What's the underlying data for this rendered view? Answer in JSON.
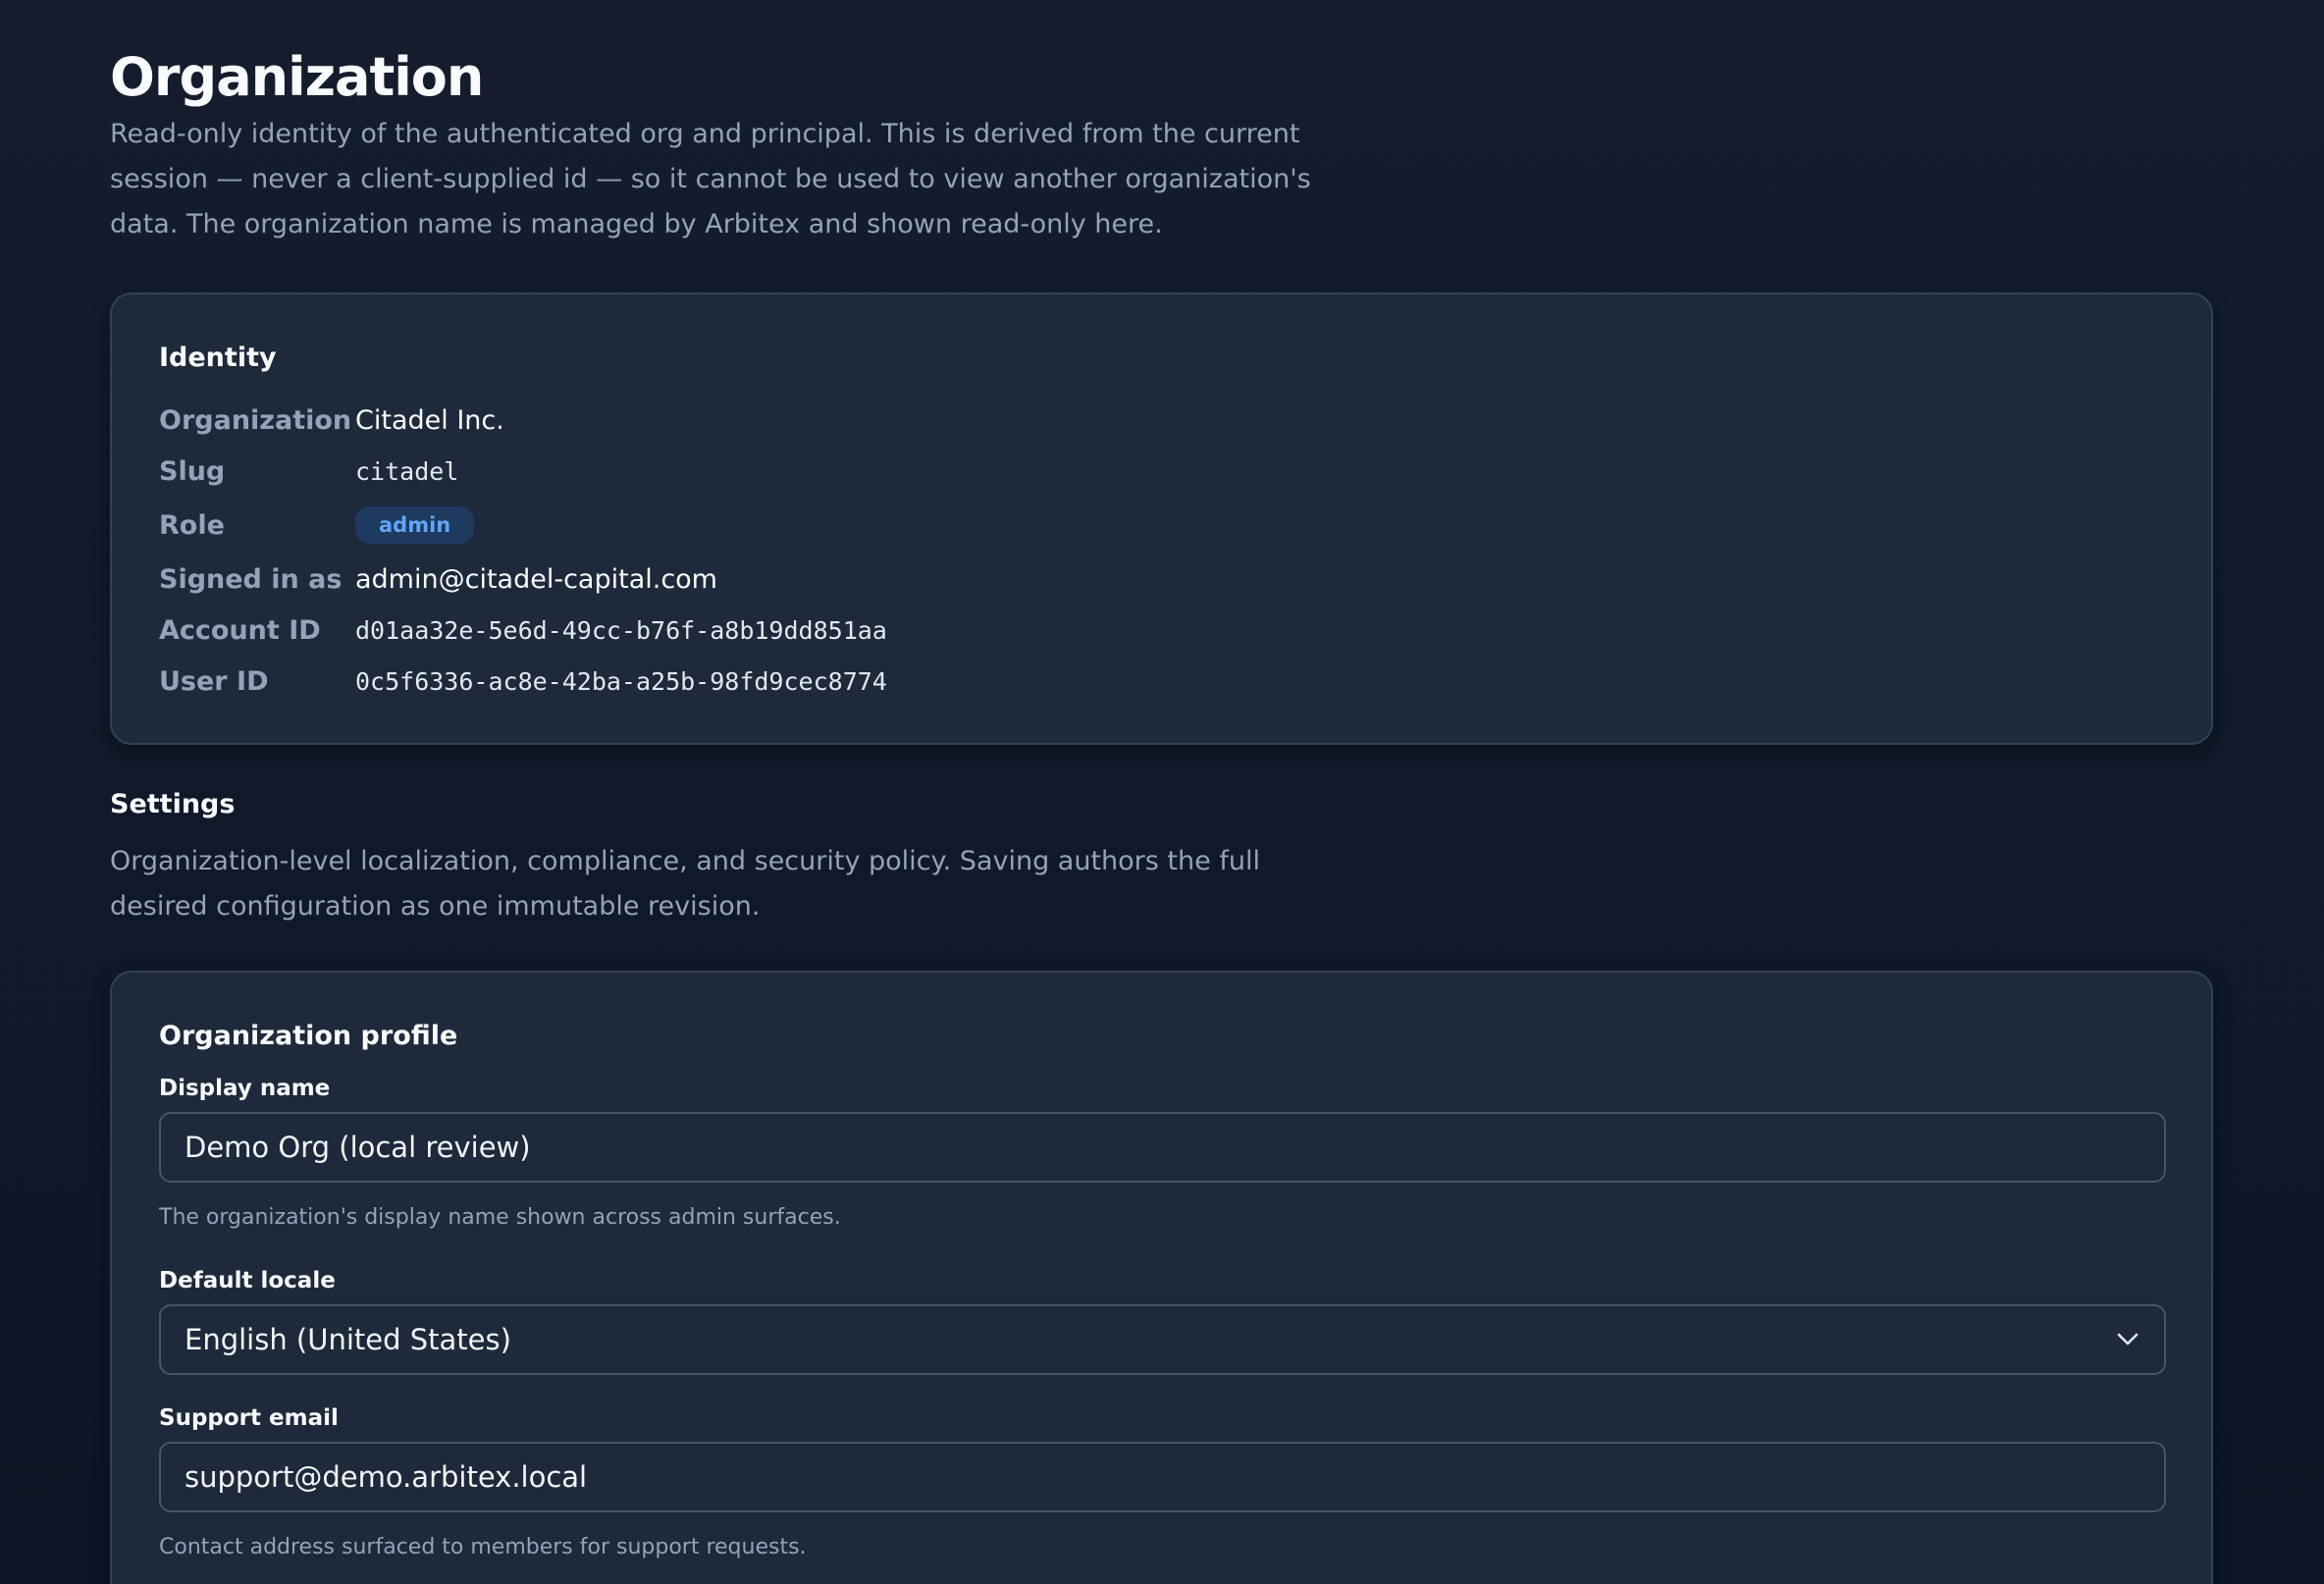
{
  "header": {
    "title": "Organization",
    "description": "Read-only identity of the authenticated org and principal. This is derived from the current session — never a client-supplied id — so it cannot be used to view another organization's data. The organization name is managed by Arbitex and shown read-only here."
  },
  "identity": {
    "title": "Identity",
    "rows": [
      {
        "label": "Organization",
        "value": "Citadel Inc."
      },
      {
        "label": "Slug",
        "value": "citadel"
      },
      {
        "label": "Role",
        "value": "admin"
      },
      {
        "label": "Signed in as",
        "value": "admin@citadel-capital.com"
      },
      {
        "label": "Account ID",
        "value": "d01aa32e-5e6d-49cc-b76f-a8b19dd851aa"
      },
      {
        "label": "User ID",
        "value": "0c5f6336-ac8e-42ba-a25b-98fd9cec8774"
      }
    ]
  },
  "settings": {
    "title": "Settings",
    "description": "Organization-level localization, compliance, and security policy. Saving authors the full desired configuration as one immutable revision."
  },
  "profile": {
    "title": "Organization profile",
    "display_name": {
      "label": "Display name",
      "value": "Demo Org (local review)",
      "hint": "The organization's display name shown across admin surfaces."
    },
    "default_locale": {
      "label": "Default locale",
      "value": "English (United States)",
      "icon": "chevron-down-icon"
    },
    "support_email": {
      "label": "Support email",
      "value": "support@demo.arbitex.local",
      "hint": "Contact address surfaced to members for support requests."
    }
  },
  "colors": {
    "background": "#0f172a",
    "card": "#1e293b",
    "border": "#334155",
    "muted_text": "#94a3b8",
    "badge_bg": "#1e3a5f",
    "badge_text": "#60a5fa"
  }
}
